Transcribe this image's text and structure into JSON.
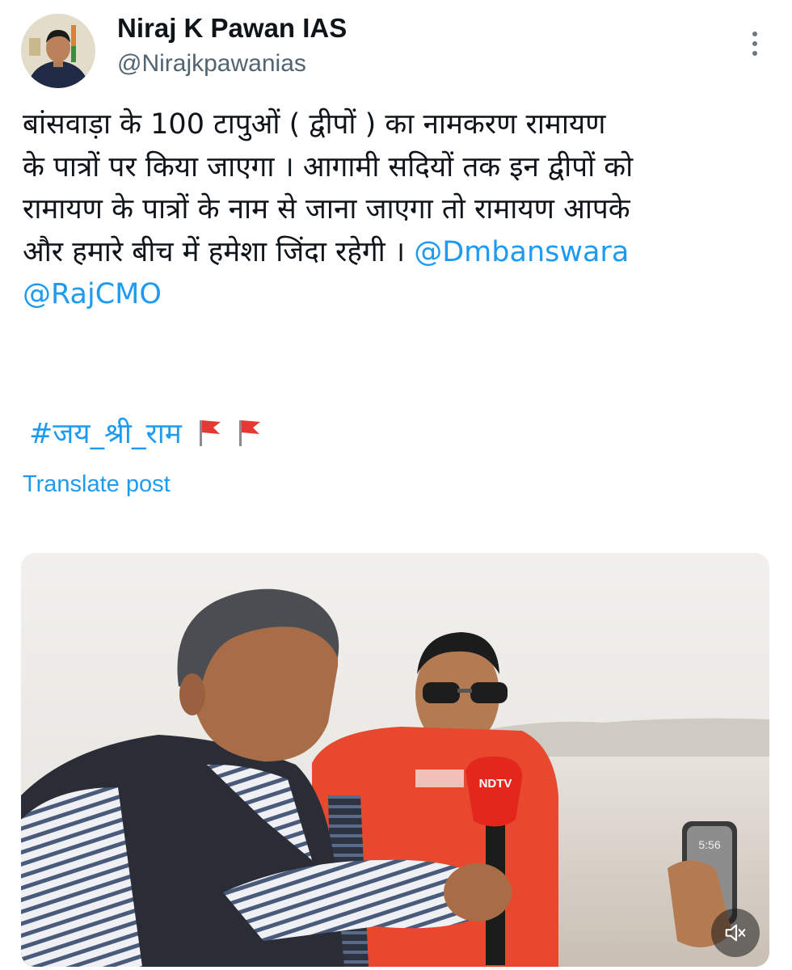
{
  "author": {
    "name": "Niraj K Pawan IAS",
    "handle": "@Nirajkpawanias",
    "avatar_icon": "profile-photo"
  },
  "more_icon": "more-vertical-icon",
  "post": {
    "line1": "बांसवाड़ा के 100 टापुओं ( द्वीपों ) का नामकरण रामायण",
    "line2": "के पात्रों पर किया जाएगा । आगामी सदियों तक इन द्वीपों को",
    "line3": "रामायण के पात्रों के नाम से जाना जाएगा तो रामायण आपके",
    "line4": "और हमारे बीच में हमेशा जिंदा रहेगी । ",
    "mention1": "@Dmbanswara",
    "mention2": "@RajCMO",
    "hashtag": "#जय_श्री_राम",
    "flag_icons": [
      "red-flag-icon",
      "red-flag-icon"
    ]
  },
  "translate_label": "Translate post",
  "media": {
    "type": "video",
    "mic_logo_text": "NDTV",
    "phone_time": "5:56",
    "mute_icon": "speaker-muted-icon"
  },
  "colors": {
    "link": "#1d9bf0",
    "text": "#0f1419",
    "secondary": "#536471",
    "life_jacket": "#e8492e"
  }
}
